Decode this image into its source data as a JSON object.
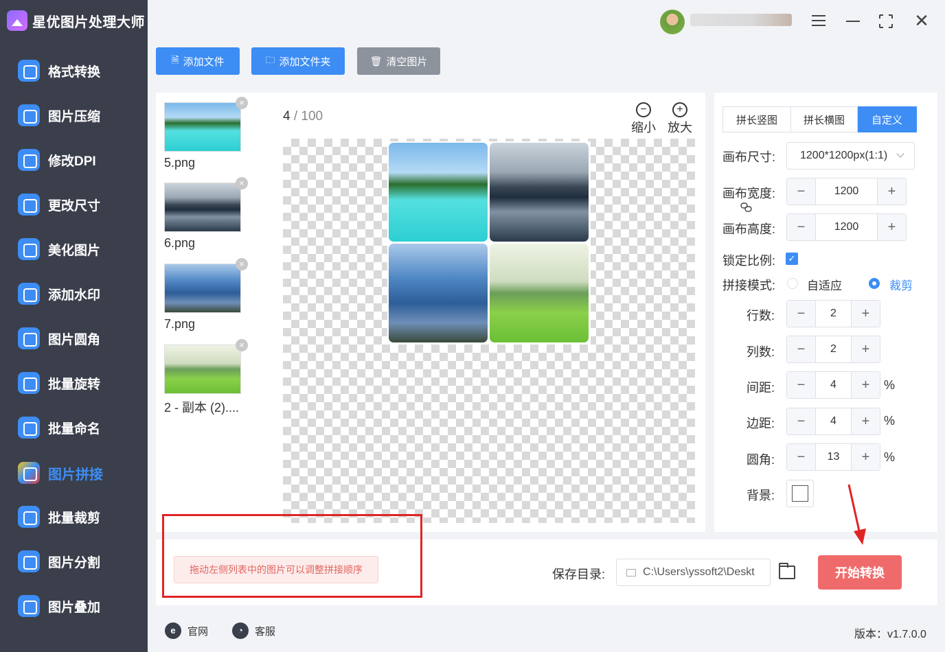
{
  "app": {
    "title": "星优图片处理大师"
  },
  "sidebar": {
    "items": [
      {
        "label": "格式转换",
        "icon": "image-convert-icon",
        "active": false
      },
      {
        "label": "图片压缩",
        "icon": "image-compress-icon",
        "active": false
      },
      {
        "label": "修改DPI",
        "icon": "dpi-icon",
        "active": false
      },
      {
        "label": "更改尺寸",
        "icon": "resize-icon",
        "active": false
      },
      {
        "label": "美化图片",
        "icon": "beautify-icon",
        "active": false
      },
      {
        "label": "添加水印",
        "icon": "watermark-icon",
        "active": false
      },
      {
        "label": "图片圆角",
        "icon": "rounded-corner-icon",
        "active": false
      },
      {
        "label": "批量旋转",
        "icon": "rotate-icon",
        "active": false
      },
      {
        "label": "批量命名",
        "icon": "rename-icon",
        "active": false
      },
      {
        "label": "图片拼接",
        "icon": "stitch-icon",
        "active": true
      },
      {
        "label": "批量裁剪",
        "icon": "crop-icon",
        "active": false
      },
      {
        "label": "图片分割",
        "icon": "split-icon",
        "active": false
      },
      {
        "label": "图片叠加",
        "icon": "layers-icon",
        "active": false
      }
    ]
  },
  "toolbar": {
    "add_file": "添加文件",
    "add_folder": "添加文件夹",
    "clear": "清空图片"
  },
  "file_list": [
    {
      "name": "5.png"
    },
    {
      "name": "6.png"
    },
    {
      "name": "7.png"
    },
    {
      "name": "2 - 副本 (2)...."
    }
  ],
  "preview": {
    "current": "4",
    "separator": " / ",
    "total": "100",
    "zoom_out": "缩小",
    "zoom_in": "放大"
  },
  "settings": {
    "tabs": [
      "拼长竖图",
      "拼长横图",
      "自定义"
    ],
    "active_tab": 2,
    "canvas_size_label": "画布尺寸:",
    "canvas_size_value": "1200*1200px(1:1)",
    "canvas_width_label": "画布宽度:",
    "canvas_width": "1200",
    "canvas_height_label": "画布高度:",
    "canvas_height": "1200",
    "lock_ratio_label": "锁定比例:",
    "lock_ratio": true,
    "mode_label": "拼接模式:",
    "mode_fit": "自适应",
    "mode_crop": "裁剪",
    "mode_selected": "裁剪",
    "rows_label": "行数:",
    "rows": "2",
    "cols_label": "列数:",
    "cols": "2",
    "spacing_label": "间距:",
    "spacing": "4",
    "margin_label": "边距:",
    "margin": "4",
    "radius_label": "圆角:",
    "radius": "13",
    "percent": "%",
    "background_label": "背景:",
    "background_color": "#ffffff"
  },
  "bottom": {
    "hint": "拖动左侧列表中的图片可以调整拼接顺序",
    "save_label": "保存目录:",
    "save_path": "C:\\Users\\yssoft2\\Deskt",
    "start": "开始转换"
  },
  "footer": {
    "website": "官网",
    "support": "客服",
    "version": "版本：v1.7.0.0"
  },
  "colors": {
    "accent": "#3d8df5",
    "sidebar_bg": "#3a3f4b",
    "start_button": "#ef6b6b",
    "annotation": "#e02424"
  }
}
